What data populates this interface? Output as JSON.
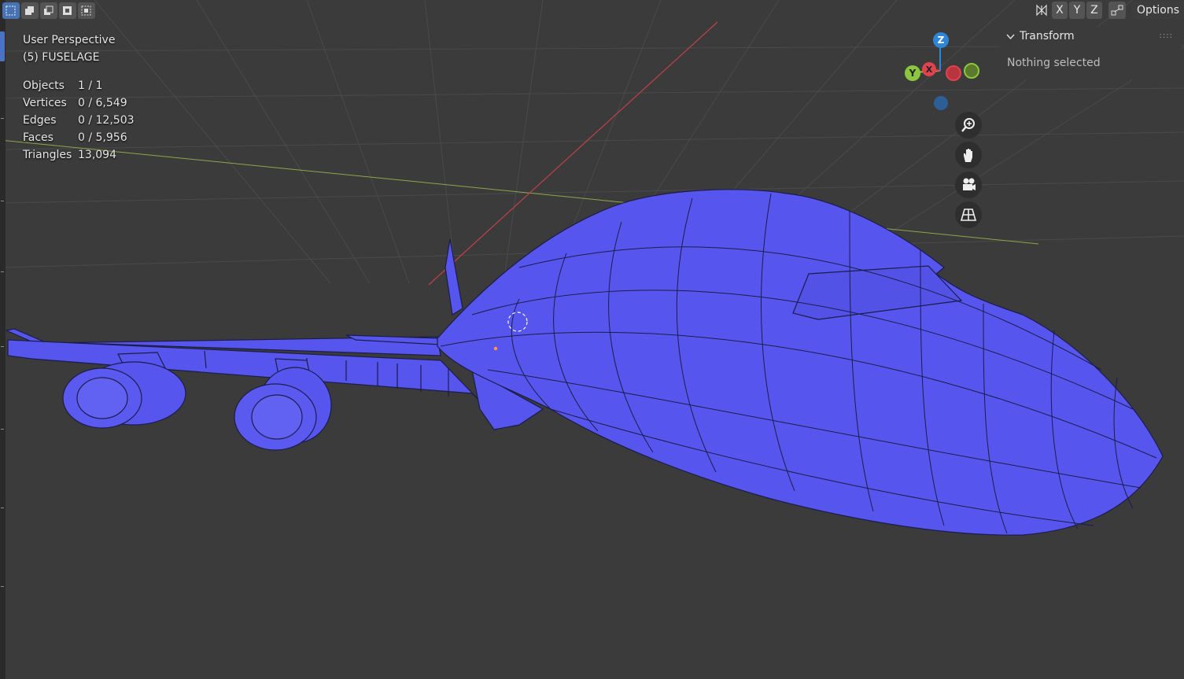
{
  "viewport": {
    "view_name": "User Perspective",
    "object_name": "(5) FUSELAGE"
  },
  "stats": [
    {
      "label": "Objects",
      "value": "1 / 1"
    },
    {
      "label": "Vertices",
      "value": "0 / 6,549"
    },
    {
      "label": "Edges",
      "value": "0 / 12,503"
    },
    {
      "label": "Faces",
      "value": "0 / 5,956"
    },
    {
      "label": "Triangles",
      "value": "13,094"
    }
  ],
  "header": {
    "mirror_x": "X",
    "mirror_y": "Y",
    "mirror_z": "Z",
    "options_label": "Options"
  },
  "gizmo": {
    "z_label": "Z",
    "y_label": "Y",
    "x_label": "X",
    "colors": {
      "x": "#e0424e",
      "y": "#8cc63f",
      "z": "#2f86d6"
    }
  },
  "npanel": {
    "title": "Transform",
    "empty_message": "Nothing selected"
  },
  "navigation": [
    "zoom-icon",
    "hand-icon",
    "camera-icon",
    "grid-icon"
  ],
  "colors": {
    "mesh": "#5656ee",
    "background": "#3b3b3b",
    "selection_active": "#4772b3"
  }
}
